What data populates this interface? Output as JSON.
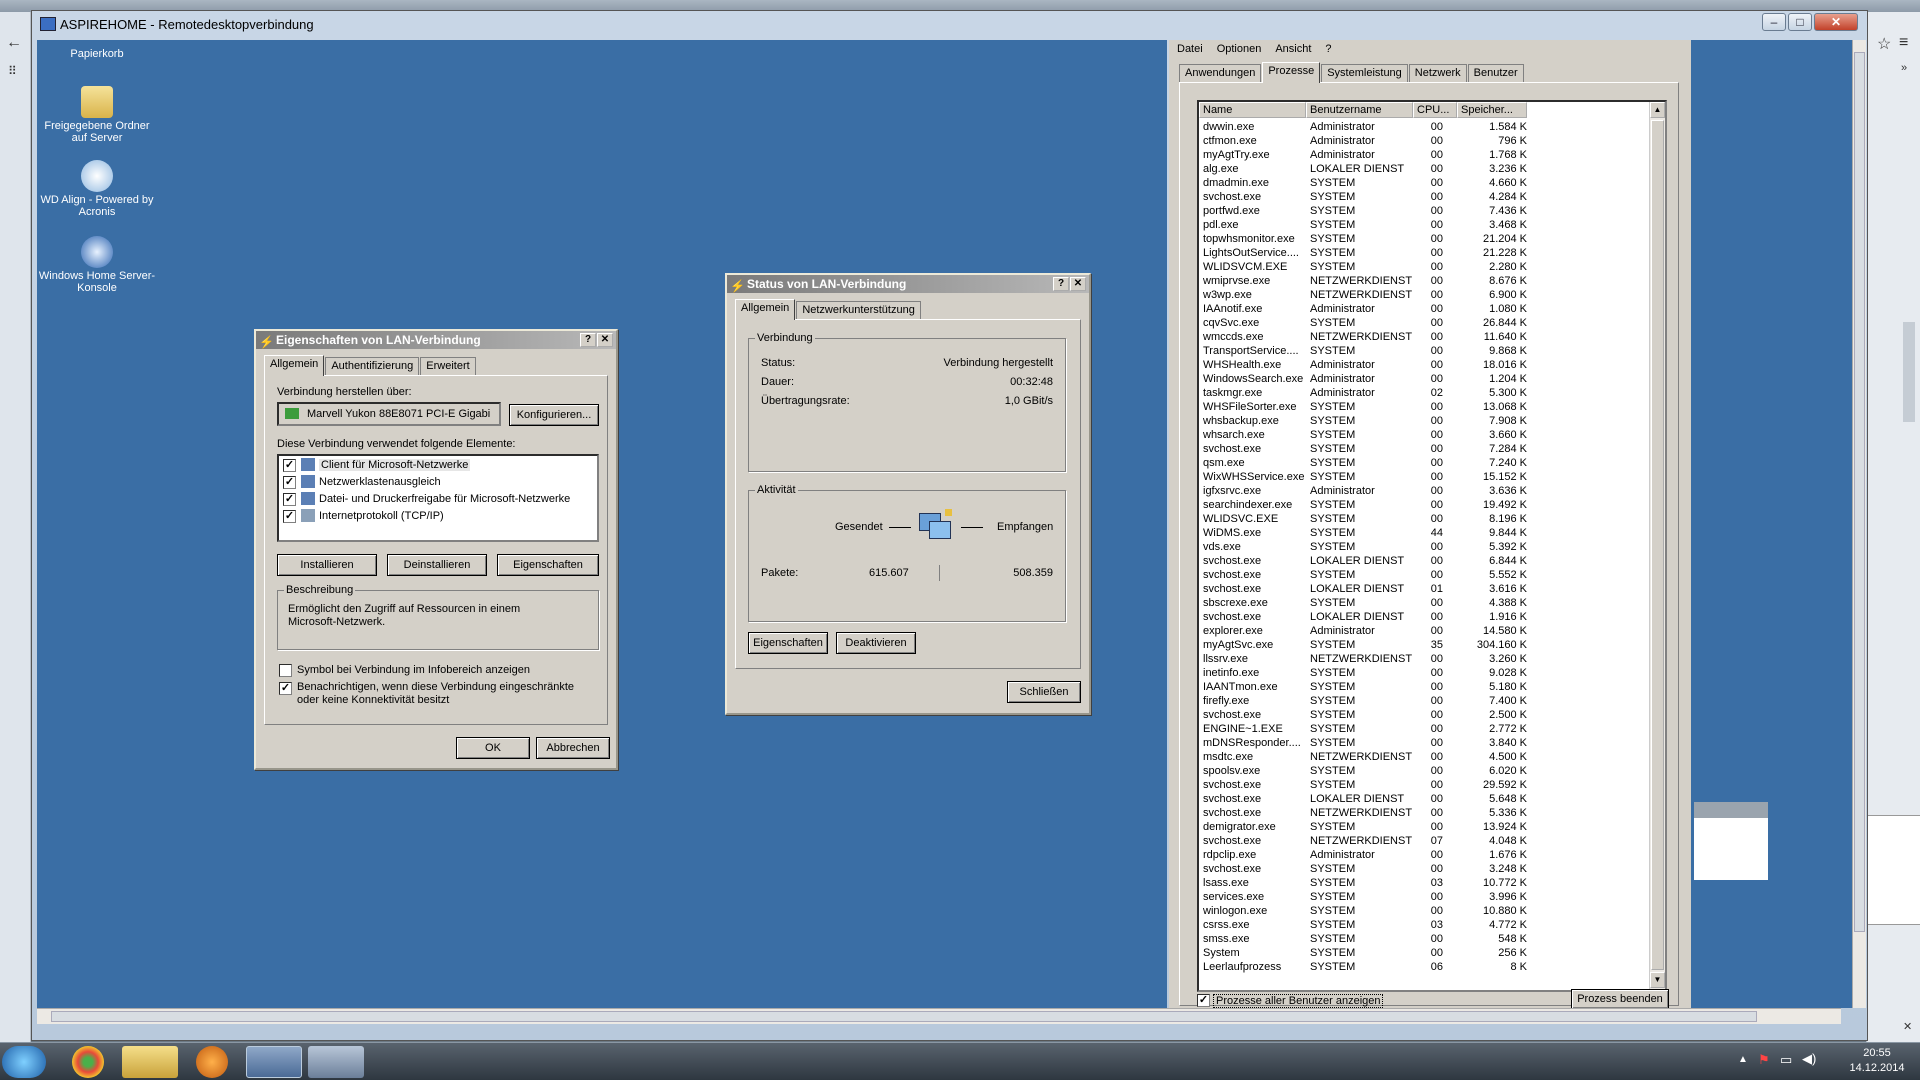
{
  "rdp_window": {
    "title": "ASPIREHOME - Remotedesktopverbindung"
  },
  "desktop_icons": [
    {
      "label": "Papierkorb"
    },
    {
      "label": "Freigegebene Ordner auf Server"
    },
    {
      "label": "WD Align - Powered by Acronis"
    },
    {
      "label": "Windows Home Server-Konsole"
    }
  ],
  "lan_props": {
    "title": "Eigenschaften von LAN-Verbindung",
    "tabs": [
      "Allgemein",
      "Authentifizierung",
      "Erweitert"
    ],
    "connect_via_label": "Verbindung herstellen über:",
    "adapter": "Marvell Yukon 88E8071 PCI-E Gigabi",
    "configure": "Konfigurieren...",
    "elements_label": "Diese Verbindung verwendet folgende Elemente:",
    "elements": [
      "Client für Microsoft-Netzwerke",
      "Netzwerklastenausgleich",
      "Datei- und Druckerfreigabe für Microsoft-Netzwerke",
      "Internetprotokoll (TCP/IP)"
    ],
    "install": "Installieren",
    "uninstall": "Deinstallieren",
    "properties": "Eigenschaften",
    "description_label": "Beschreibung",
    "description": "Ermöglicht den Zugriff auf Ressourcen in einem Microsoft-Netzwerk.",
    "show_icon": "Symbol bei Verbindung im Infobereich anzeigen",
    "notify": "Benachrichtigen, wenn diese Verbindung eingeschränkte oder keine Konnektivität besitzt",
    "ok": "OK",
    "cancel": "Abbrechen"
  },
  "lan_status": {
    "title": "Status von LAN-Verbindung",
    "tabs": [
      "Allgemein",
      "Netzwerkunterstützung"
    ],
    "connection_label": "Verbindung",
    "status_label": "Status:",
    "status_value": "Verbindung hergestellt",
    "duration_label": "Dauer:",
    "duration_value": "00:32:48",
    "speed_label": "Übertragungsrate:",
    "speed_value": "1,0 GBit/s",
    "activity_label": "Aktivität",
    "sent_label": "Gesendet",
    "received_label": "Empfangen",
    "packets_label": "Pakete:",
    "packets_sent": "615.607",
    "packets_received": "508.359",
    "properties": "Eigenschaften",
    "disable": "Deaktivieren",
    "close": "Schließen"
  },
  "task_manager": {
    "menu": [
      "Datei",
      "Optionen",
      "Ansicht",
      "?"
    ],
    "tabs": [
      "Anwendungen",
      "Prozesse",
      "Systemleistung",
      "Netzwerk",
      "Benutzer"
    ],
    "columns": [
      "Name",
      "Benutzername",
      "CPU...",
      "Speicher..."
    ],
    "processes": [
      [
        "dwwin.exe",
        "Administrator",
        "00",
        "1.584 K"
      ],
      [
        "ctfmon.exe",
        "Administrator",
        "00",
        "796 K"
      ],
      [
        "myAgtTry.exe",
        "Administrator",
        "00",
        "1.768 K"
      ],
      [
        "alg.exe",
        "LOKALER DIENST",
        "00",
        "3.236 K"
      ],
      [
        "dmadmin.exe",
        "SYSTEM",
        "00",
        "4.660 K"
      ],
      [
        "svchost.exe",
        "SYSTEM",
        "00",
        "4.284 K"
      ],
      [
        "portfwd.exe",
        "SYSTEM",
        "00",
        "7.436 K"
      ],
      [
        "pdl.exe",
        "SYSTEM",
        "00",
        "3.468 K"
      ],
      [
        "topwhsmonitor.exe",
        "SYSTEM",
        "00",
        "21.204 K"
      ],
      [
        "LightsOutService....",
        "SYSTEM",
        "00",
        "21.228 K"
      ],
      [
        "WLIDSVCM.EXE",
        "SYSTEM",
        "00",
        "2.280 K"
      ],
      [
        "wmiprvse.exe",
        "NETZWERKDIENST",
        "00",
        "8.676 K"
      ],
      [
        "w3wp.exe",
        "NETZWERKDIENST",
        "00",
        "6.900 K"
      ],
      [
        "IAAnotif.exe",
        "Administrator",
        "00",
        "1.080 K"
      ],
      [
        "cqvSvc.exe",
        "SYSTEM",
        "00",
        "26.844 K"
      ],
      [
        "wmccds.exe",
        "NETZWERKDIENST",
        "00",
        "11.640 K"
      ],
      [
        "TransportService....",
        "SYSTEM",
        "00",
        "9.868 K"
      ],
      [
        "WHSHealth.exe",
        "Administrator",
        "00",
        "18.016 K"
      ],
      [
        "WindowsSearch.exe",
        "Administrator",
        "00",
        "1.204 K"
      ],
      [
        "taskmgr.exe",
        "Administrator",
        "02",
        "5.300 K"
      ],
      [
        "WHSFileSorter.exe",
        "SYSTEM",
        "00",
        "13.068 K"
      ],
      [
        "whsbackup.exe",
        "SYSTEM",
        "00",
        "7.908 K"
      ],
      [
        "whsarch.exe",
        "SYSTEM",
        "00",
        "3.660 K"
      ],
      [
        "svchost.exe",
        "SYSTEM",
        "00",
        "7.284 K"
      ],
      [
        "qsm.exe",
        "SYSTEM",
        "00",
        "7.240 K"
      ],
      [
        "WixWHSService.exe",
        "SYSTEM",
        "00",
        "15.152 K"
      ],
      [
        "igfxsrvc.exe",
        "Administrator",
        "00",
        "3.636 K"
      ],
      [
        "searchindexer.exe",
        "SYSTEM",
        "00",
        "19.492 K"
      ],
      [
        "WLIDSVC.EXE",
        "SYSTEM",
        "00",
        "8.196 K"
      ],
      [
        "WiDMS.exe",
        "SYSTEM",
        "44",
        "9.844 K"
      ],
      [
        "vds.exe",
        "SYSTEM",
        "00",
        "5.392 K"
      ],
      [
        "svchost.exe",
        "LOKALER DIENST",
        "00",
        "6.844 K"
      ],
      [
        "svchost.exe",
        "SYSTEM",
        "00",
        "5.552 K"
      ],
      [
        "svchost.exe",
        "LOKALER DIENST",
        "01",
        "3.616 K"
      ],
      [
        "sbscrexe.exe",
        "SYSTEM",
        "00",
        "4.388 K"
      ],
      [
        "svchost.exe",
        "LOKALER DIENST",
        "00",
        "1.916 K"
      ],
      [
        "explorer.exe",
        "Administrator",
        "00",
        "14.580 K"
      ],
      [
        "myAgtSvc.exe",
        "SYSTEM",
        "35",
        "304.160 K"
      ],
      [
        "llssrv.exe",
        "NETZWERKDIENST",
        "00",
        "3.260 K"
      ],
      [
        "inetinfo.exe",
        "SYSTEM",
        "00",
        "9.028 K"
      ],
      [
        "IAANTmon.exe",
        "SYSTEM",
        "00",
        "5.180 K"
      ],
      [
        "firefly.exe",
        "SYSTEM",
        "00",
        "7.400 K"
      ],
      [
        "svchost.exe",
        "SYSTEM",
        "00",
        "2.500 K"
      ],
      [
        "ENGINE~1.EXE",
        "SYSTEM",
        "00",
        "2.772 K"
      ],
      [
        "mDNSResponder....",
        "SYSTEM",
        "00",
        "3.840 K"
      ],
      [
        "msdtc.exe",
        "NETZWERKDIENST",
        "00",
        "4.500 K"
      ],
      [
        "spoolsv.exe",
        "SYSTEM",
        "00",
        "6.020 K"
      ],
      [
        "svchost.exe",
        "SYSTEM",
        "00",
        "29.592 K"
      ],
      [
        "svchost.exe",
        "LOKALER DIENST",
        "00",
        "5.648 K"
      ],
      [
        "svchost.exe",
        "NETZWERKDIENST",
        "00",
        "5.336 K"
      ],
      [
        "demigrator.exe",
        "SYSTEM",
        "00",
        "13.924 K"
      ],
      [
        "svchost.exe",
        "NETZWERKDIENST",
        "07",
        "4.048 K"
      ],
      [
        "rdpclip.exe",
        "Administrator",
        "00",
        "1.676 K"
      ],
      [
        "svchost.exe",
        "SYSTEM",
        "00",
        "3.248 K"
      ],
      [
        "lsass.exe",
        "SYSTEM",
        "03",
        "10.772 K"
      ],
      [
        "services.exe",
        "SYSTEM",
        "00",
        "3.996 K"
      ],
      [
        "winlogon.exe",
        "SYSTEM",
        "00",
        "10.880 K"
      ],
      [
        "csrss.exe",
        "SYSTEM",
        "03",
        "4.772 K"
      ],
      [
        "smss.exe",
        "SYSTEM",
        "00",
        "548 K"
      ],
      [
        "System",
        "SYSTEM",
        "00",
        "256 K"
      ],
      [
        "Leerlaufprozess",
        "SYSTEM",
        "06",
        "8 K"
      ]
    ],
    "show_all_users": "Prozesse aller Benutzer anzeigen",
    "end_process": "Prozess beenden"
  },
  "clock": {
    "time": "20:55",
    "date": "14.12.2014"
  },
  "colors": {
    "desktop": "#3a6ea5",
    "dialog": "#d4d0c8"
  }
}
